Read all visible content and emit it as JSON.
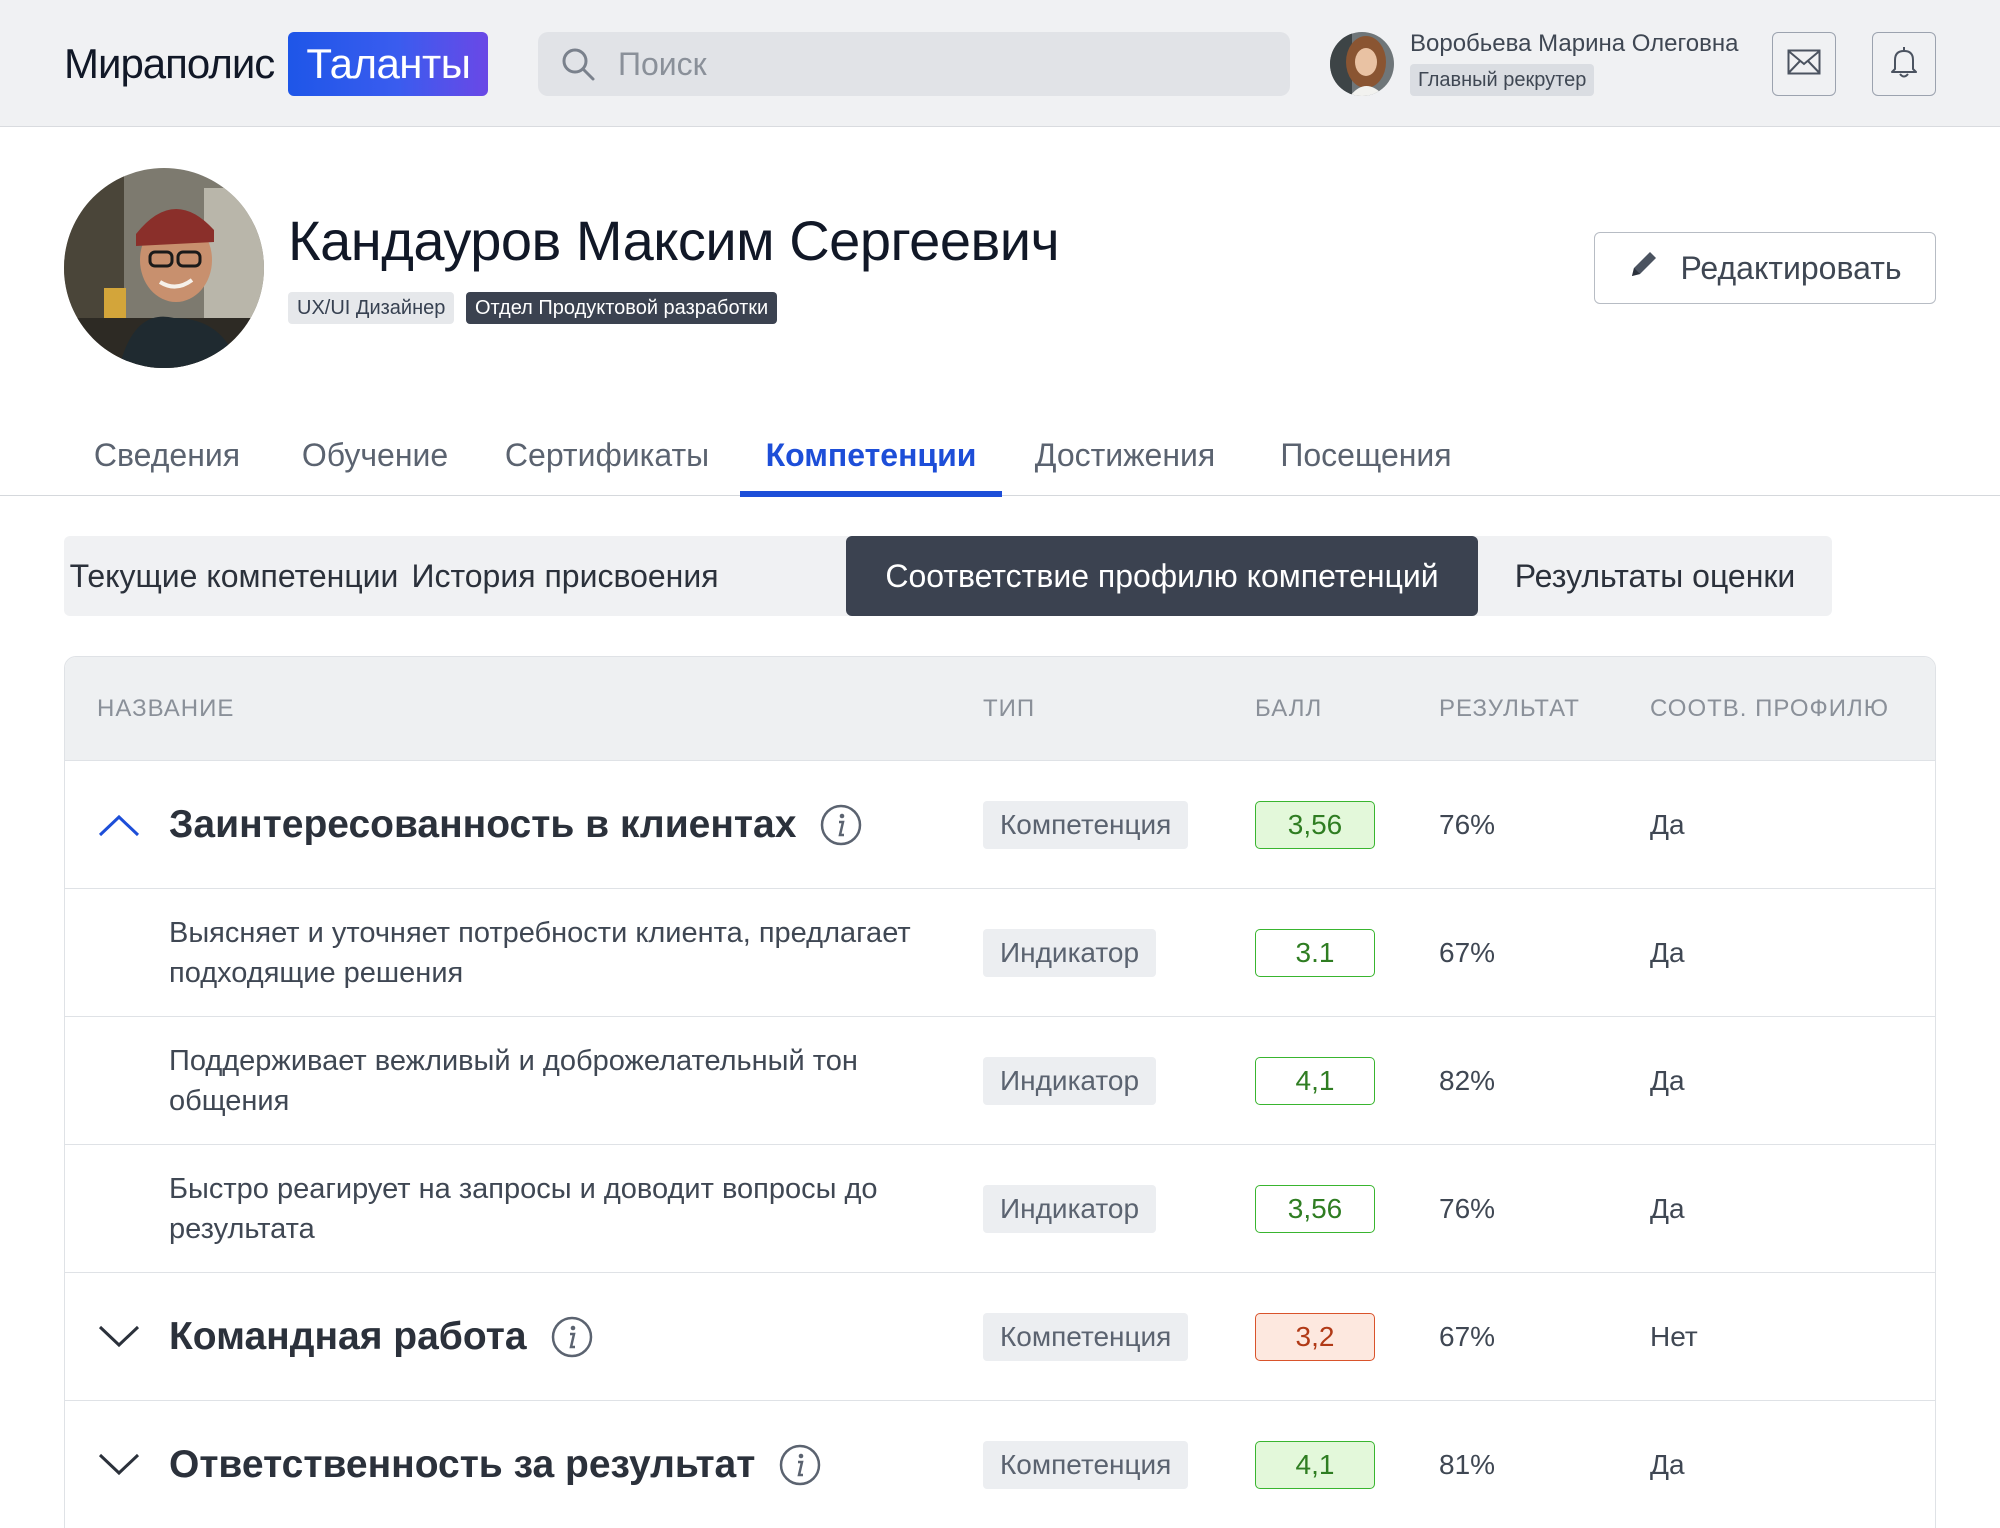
{
  "header": {
    "logo_text": "Мираполис",
    "logo_badge": "Таланты",
    "search_placeholder": "Поиск",
    "user_name": "Воробьева Марина Олеговна",
    "user_role": "Главный рекрутер",
    "icons": [
      "search-icon",
      "mail-icon",
      "bell-icon"
    ]
  },
  "profile": {
    "full_name": "Кандауров Максим Сергеевич",
    "position": "UX/UI Дизайнер",
    "department": "Отдел Продуктовой разработки",
    "edit_label": "Редактировать"
  },
  "tabs": [
    "Сведения",
    "Обучение",
    "Сертификаты",
    "Компетенции",
    "Достижения",
    "Посещения"
  ],
  "active_tab": "Компетенции",
  "subtabs": [
    "Текущие компетенции",
    "История присвоения",
    "Соответствие профилю компетенций",
    "Результаты оценки"
  ],
  "active_subtab": "Соответствие профилю компетенций",
  "table": {
    "columns": [
      "НАЗВАНИЕ",
      "ТИП",
      "БАЛЛ",
      "РЕЗУЛЬТАТ",
      "СООТВ. ПРОФИЛЮ"
    ],
    "rows": [
      {
        "kind": "group",
        "expanded": true,
        "name": "Заинтересованность в клиентах",
        "type": "Компетенция",
        "score": "3,56",
        "score_status": "ok",
        "result": "76%",
        "match": "Да"
      },
      {
        "kind": "indicator",
        "name": "Выясняет и уточняет потребности клиента, предлагает подходящие решения",
        "type": "Индикатор",
        "score": "3.1",
        "score_status": "ok-outline",
        "result": "67%",
        "match": "Да"
      },
      {
        "kind": "indicator",
        "name": "Поддерживает вежливый и доброжелательный тон общения",
        "type": "Индикатор",
        "score": "4,1",
        "score_status": "ok-outline",
        "result": "82%",
        "match": "Да"
      },
      {
        "kind": "indicator",
        "name": "Быстро реагирует на запросы и доводит вопросы до результата",
        "type": "Индикатор",
        "score": "3,56",
        "score_status": "ok-outline",
        "result": "76%",
        "match": "Да"
      },
      {
        "kind": "group",
        "expanded": false,
        "name": "Командная работа",
        "type": "Компетенция",
        "score": "3,2",
        "score_status": "bad",
        "result": "67%",
        "match": "Нет"
      },
      {
        "kind": "group",
        "expanded": false,
        "name": "Ответственность за результат",
        "type": "Компетенция",
        "score": "4,1",
        "score_status": "ok",
        "result": "81%",
        "match": "Да"
      }
    ]
  },
  "colors": {
    "accent": "#1d4ed8",
    "dark_chip": "#3b4250",
    "score_ok_border": "#39b52f",
    "score_bad_border": "#d9532b"
  }
}
